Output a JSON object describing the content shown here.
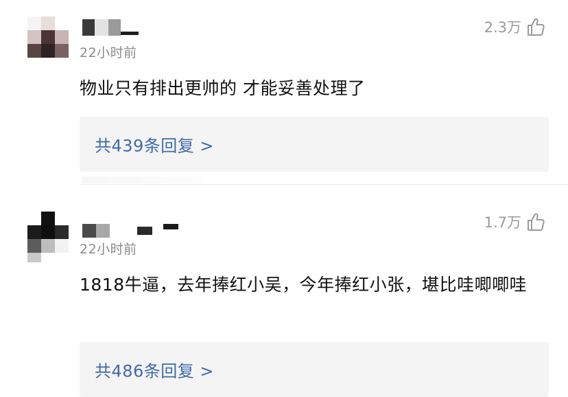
{
  "colors": {
    "link": "#3e6aa8",
    "meta_text": "#8a8a8a",
    "reply_bg": "#f4f4f4"
  },
  "comments": [
    {
      "time": "22小时前",
      "likes": "2.3万",
      "like_icon": "thumbs-up-icon",
      "body": "物业只有排出更帅的 才能妥善处理了",
      "replies_label": "共439条回复 >"
    },
    {
      "time": "22小时前",
      "likes": "1.7万",
      "like_icon": "thumbs-up-icon",
      "body": "1818牛逼，去年捧红小吴，今年捧红小张，堪比哇唧唧哇",
      "replies_label": "共486条回复 >"
    }
  ]
}
